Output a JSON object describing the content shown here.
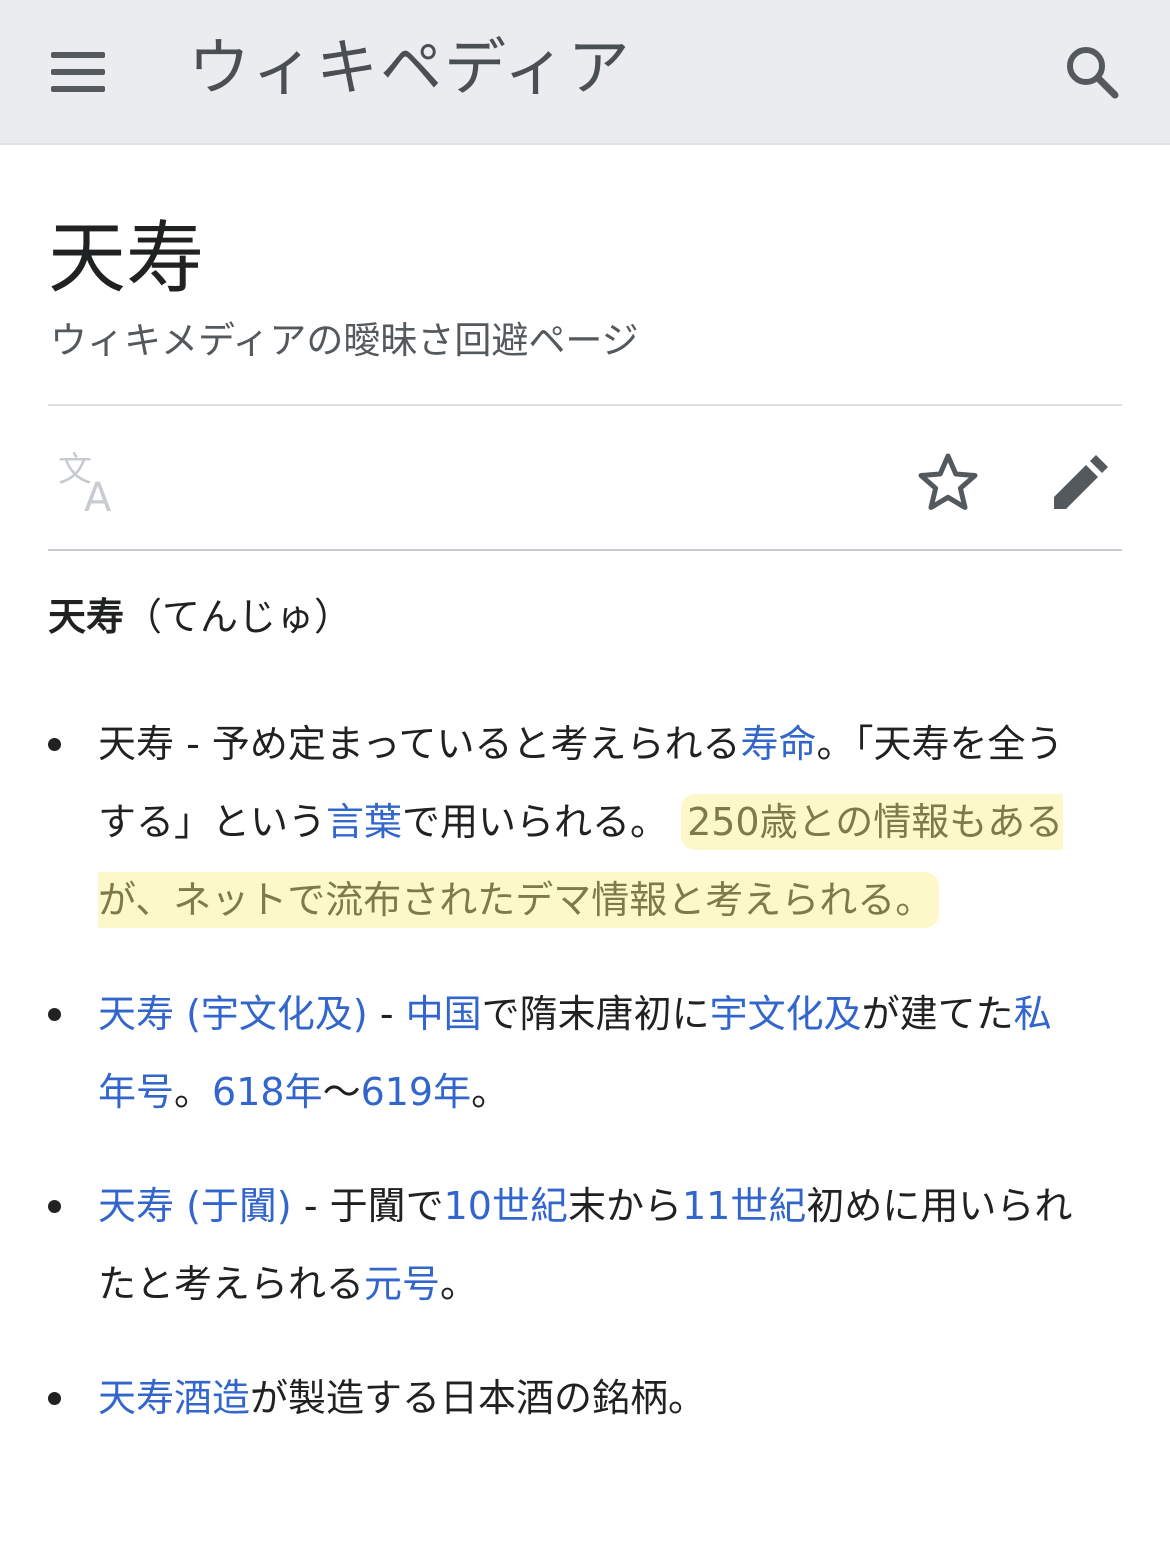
{
  "header": {
    "wordmark": "ウィキペディア",
    "menu_icon": "hamburger-menu-icon",
    "search_icon": "search-icon"
  },
  "page": {
    "title": "天寿",
    "description": "ウィキメディアの曖昧さ回避ページ"
  },
  "toolbar": {
    "language_icon": "translate-icon",
    "watch_icon": "star-icon",
    "edit_icon": "pencil-icon"
  },
  "lead": {
    "term": "天寿",
    "reading": "（てんじゅ）"
  },
  "items": [
    {
      "t1": "天寿 - 予め定まっていると考えられる",
      "link1": "寿命",
      "t2": "。「天寿を全うする」という",
      "link2": "言葉",
      "t3": "で用いられる。",
      "highlight": "250歳との情報もあるが、ネットで流布されたデマ情報と考えられる。"
    },
    {
      "link1": "天寿 (宇文化及)",
      "t1": " - ",
      "link2": "中国",
      "t2": "で隋末唐初に",
      "link3": "宇文化及",
      "t3": "が建てた",
      "link4": "私年号",
      "t4": "。",
      "link5": "618年",
      "t5": "〜",
      "link6": "619年",
      "t6": "。"
    },
    {
      "link1": "天寿 (于闐)",
      "t1": " - 于闐で",
      "link2": "10世紀",
      "t2": "末から",
      "link3": "11世紀",
      "t3": "初めに用いられたと考えられる",
      "link4": "元号",
      "t4": "。"
    },
    {
      "link1": "天寿酒造",
      "t1": "が製造する日本酒の銘柄。"
    }
  ],
  "colors": {
    "header_bg": "#eaecf0",
    "link": "#3366cc",
    "highlight_bg": "#fdf8c9",
    "text": "#202122"
  }
}
